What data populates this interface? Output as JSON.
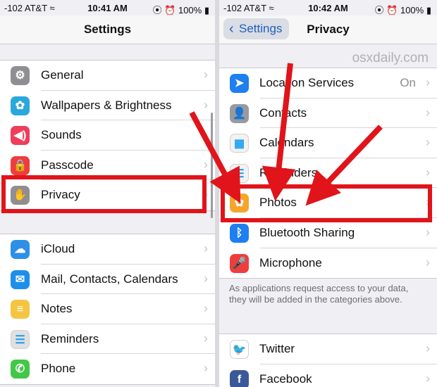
{
  "left": {
    "status": {
      "carrier": "-102 AT&T ≈",
      "time": "10:41 AM",
      "battery": "⦿ ⏰ 100% ▮"
    },
    "nav": {
      "title": "Settings"
    },
    "group1": [
      {
        "label": "General",
        "icon": "gear-icon",
        "glyph": "⚙",
        "color": "#8e8e93"
      },
      {
        "label": "Wallpapers & Brightness",
        "icon": "wallpaper-flower-icon",
        "glyph": "✿",
        "color": "#2aa7dc"
      },
      {
        "label": "Sounds",
        "icon": "speaker-icon",
        "glyph": "◀)",
        "color": "#ef3d5b"
      },
      {
        "label": "Passcode",
        "icon": "lock-icon",
        "glyph": "🔒",
        "color": "#ef3d3d"
      },
      {
        "label": "Privacy",
        "icon": "hand-icon",
        "glyph": "✋",
        "color": "#8e8e93"
      }
    ],
    "group2": [
      {
        "label": "iCloud",
        "icon": "cloud-icon",
        "glyph": "☁",
        "color": "#2e8fe6"
      },
      {
        "label": "Mail, Contacts, Calendars",
        "icon": "mail-icon",
        "glyph": "✉",
        "color": "#1d8fe8"
      },
      {
        "label": "Notes",
        "icon": "notes-icon",
        "glyph": "≡",
        "color": "#f5c542"
      },
      {
        "label": "Reminders",
        "icon": "reminders-icon",
        "glyph": "☰",
        "color": "#e0e0e0"
      },
      {
        "label": "Phone",
        "icon": "phone-icon",
        "glyph": "✆",
        "color": "#42c748"
      }
    ]
  },
  "right": {
    "status": {
      "carrier": "-102 AT&T ≈",
      "time": "10:42 AM",
      "battery": "⦿ ⏰ 100% ▮"
    },
    "nav": {
      "back": "Settings",
      "title": "Privacy"
    },
    "watermark": "osxdaily.com",
    "group1": [
      {
        "label": "Location Services",
        "value": "On",
        "icon": "location-arrow-icon",
        "glyph": "➤",
        "color": "#1d7ff0"
      },
      {
        "label": "Contacts",
        "value": "",
        "icon": "contacts-icon",
        "glyph": "👤",
        "color": "#9a9a9e"
      },
      {
        "label": "Calendars",
        "value": "",
        "icon": "calendar-icon",
        "glyph": "▦",
        "color": "#f2f2f2"
      },
      {
        "label": "Reminders",
        "value": "",
        "icon": "reminders-icon",
        "glyph": "☰",
        "color": "#f2f2f2"
      },
      {
        "label": "Photos",
        "value": "",
        "icon": "photos-icon",
        "glyph": "✿",
        "color": "#f4a62a"
      },
      {
        "label": "Bluetooth Sharing",
        "value": "",
        "icon": "bluetooth-icon",
        "glyph": "ᛒ",
        "color": "#1d7ff0"
      },
      {
        "label": "Microphone",
        "value": "",
        "icon": "microphone-icon",
        "glyph": "🎤",
        "color": "#ef3d3d"
      }
    ],
    "footnote": "As applications request access to your data, they will be added in the categories above.",
    "group2": [
      {
        "label": "Twitter",
        "icon": "twitter-icon",
        "glyph": "🐦",
        "color": "#ffffff"
      },
      {
        "label": "Facebook",
        "icon": "facebook-icon",
        "glyph": "f",
        "color": "#3b5998"
      }
    ]
  },
  "colors": {
    "highlight": "#e0141a",
    "arrow": "#e0141a"
  }
}
